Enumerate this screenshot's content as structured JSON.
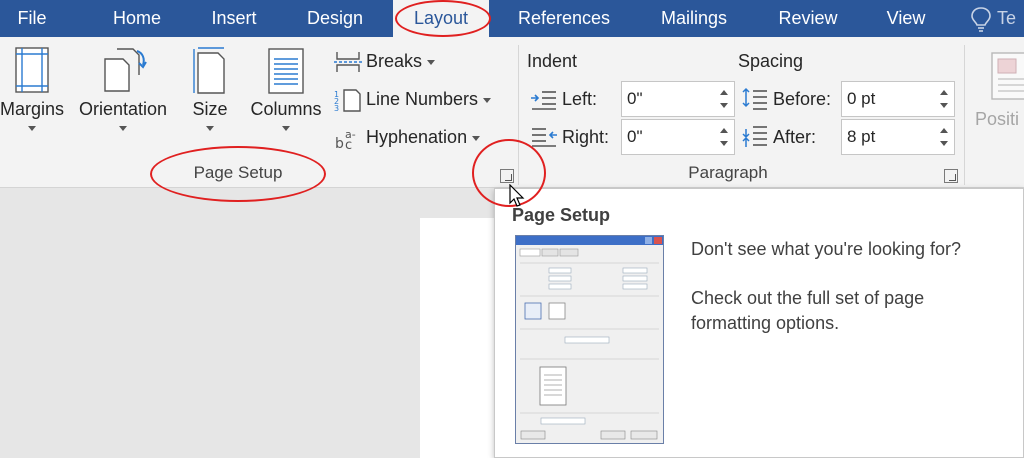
{
  "tabs": [
    {
      "label": "File"
    },
    {
      "label": "Home"
    },
    {
      "label": "Insert"
    },
    {
      "label": "Design"
    },
    {
      "label": "Layout"
    },
    {
      "label": "References"
    },
    {
      "label": "Mailings"
    },
    {
      "label": "Review"
    },
    {
      "label": "View"
    }
  ],
  "tell_me": {
    "label": "Te",
    "icon": "lightbulb-icon"
  },
  "page_setup": {
    "group_label": "Page Setup",
    "margins_label": "Margins",
    "orientation_label": "Orientation",
    "size_label": "Size",
    "columns_label": "Columns",
    "breaks_label": "Breaks",
    "line_numbers_label": "Line Numbers",
    "hyphenation_label": "Hyphenation"
  },
  "paragraph": {
    "group_label": "Paragraph",
    "indent_header": "Indent",
    "spacing_header": "Spacing",
    "left_label": "Left:",
    "left_value": "0\"",
    "right_label": "Right:",
    "right_value": "0\"",
    "before_label": "Before:",
    "before_value": "0 pt",
    "after_label": "After:",
    "after_value": "8 pt"
  },
  "arrange": {
    "position_label": "Positi"
  },
  "tooltip": {
    "title": "Page Setup",
    "line1": "Don't see what you're looking for?",
    "line2": "Check out the full set of page formatting options."
  },
  "colors": {
    "accent": "#2b579a",
    "annotation": "#e02020",
    "ribbon": "#f3f3f3"
  }
}
